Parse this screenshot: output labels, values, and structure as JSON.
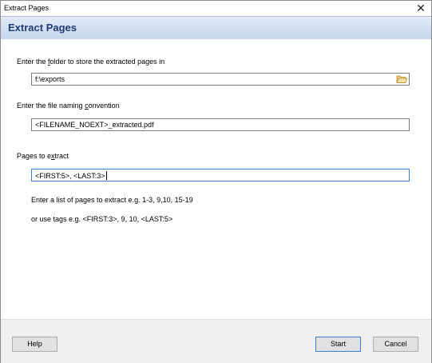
{
  "window": {
    "title": "Extract Pages"
  },
  "header": {
    "title": "Extract Pages"
  },
  "folder": {
    "label_pre": "Enter the ",
    "label_key": "f",
    "label_post": "older to store the extracted pages in",
    "value": "f:\\exports"
  },
  "naming": {
    "label_pre": "Enter the file naming ",
    "label_key": "c",
    "label_post": "onvention",
    "value": "<FILENAME_NOEXT>_extracted.pdf"
  },
  "pages": {
    "label_pre": "Pages to e",
    "label_key": "x",
    "label_post": "tract",
    "value": "<FIRST:5>, <LAST:3>",
    "hint1": "Enter a list of pages to extract e.g. 1-3, 9,10, 15-19",
    "hint2": "or use tags e.g. <FIRST:3>, 9, 10, <LAST:5>"
  },
  "buttons": {
    "help": "Help",
    "start": "Start",
    "cancel": "Cancel"
  },
  "icons": {
    "close": "close-icon",
    "folder": "folder-icon"
  }
}
